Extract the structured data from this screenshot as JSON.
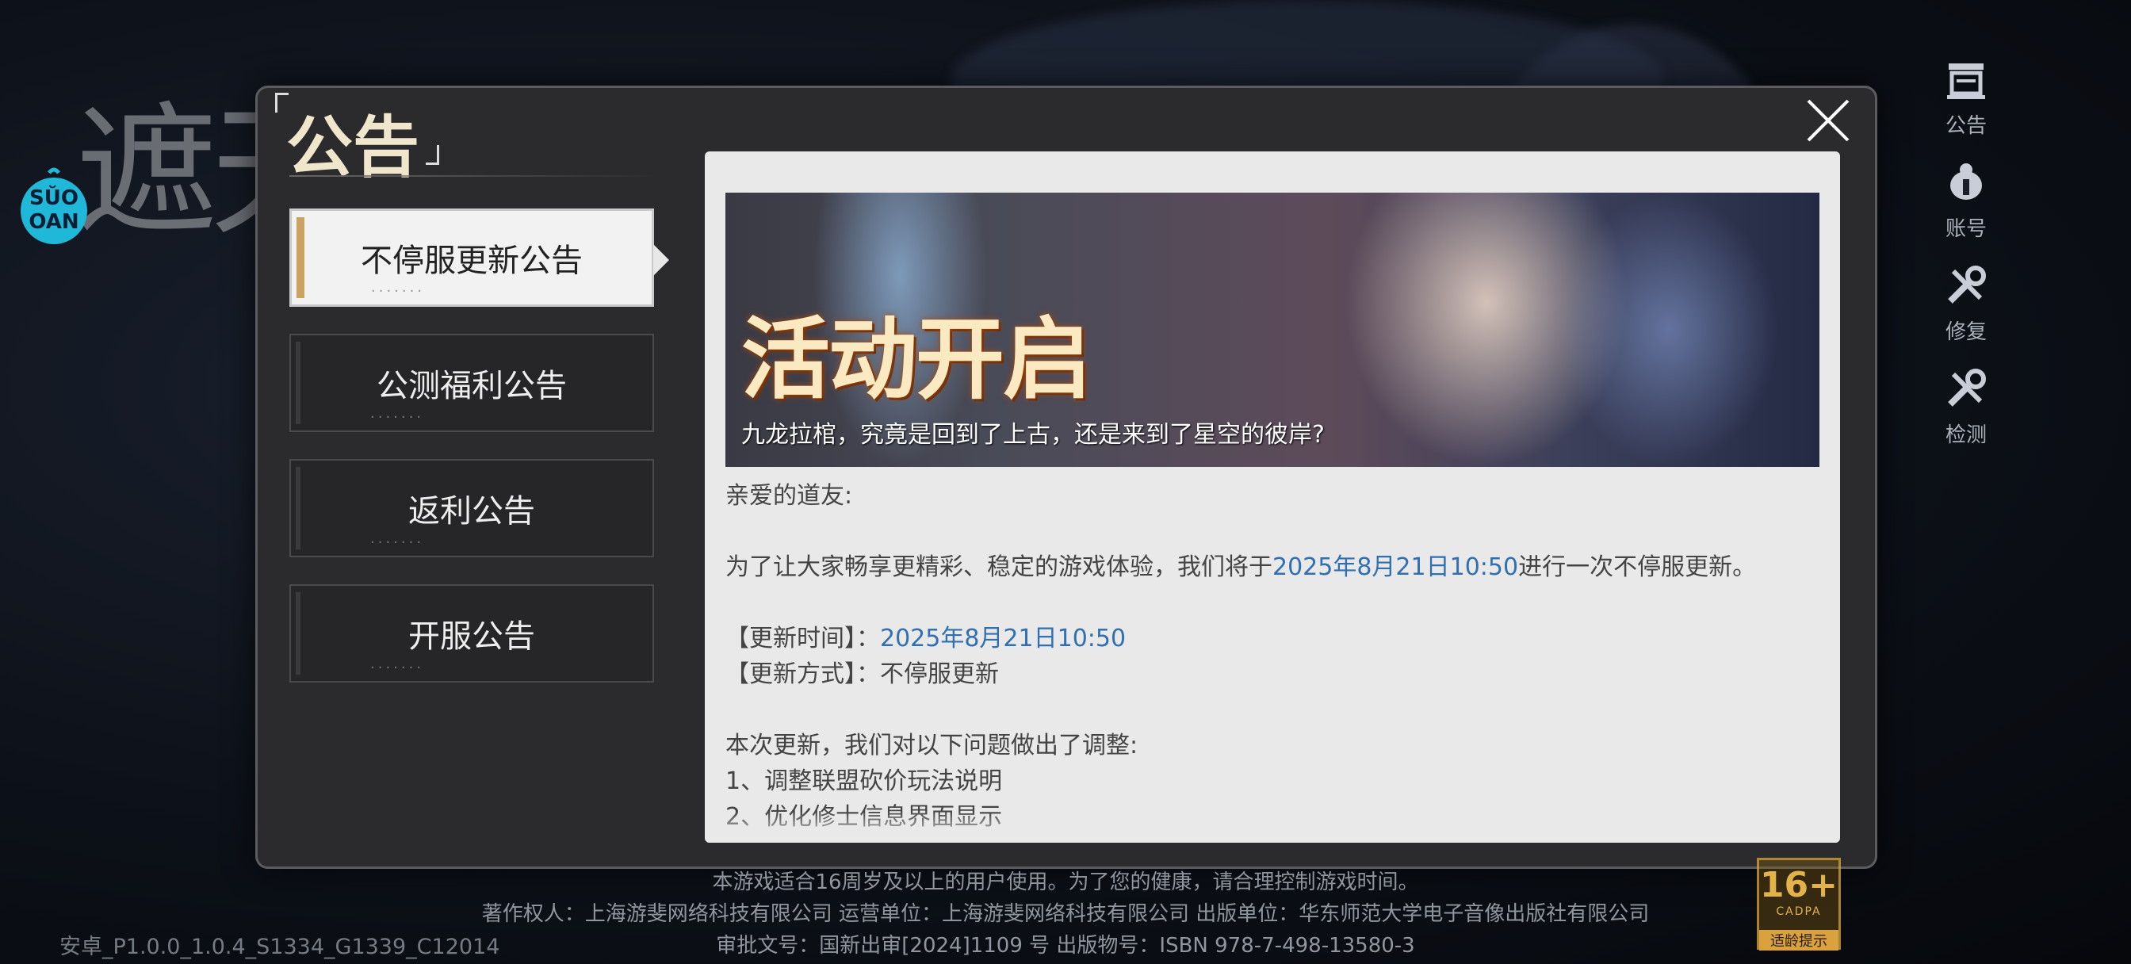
{
  "background": {
    "game_title": "遮天",
    "logo_text": "SŬO OAN"
  },
  "side_menu": [
    {
      "label": "公告",
      "icon": "announcement-icon"
    },
    {
      "label": "账号",
      "icon": "account-icon"
    },
    {
      "label": "修复",
      "icon": "repair-icon"
    },
    {
      "label": "检测",
      "icon": "detect-icon"
    }
  ],
  "dialog": {
    "title": "公告",
    "tabs": [
      {
        "label": "不停服更新公告",
        "active": true
      },
      {
        "label": "公测福利公告",
        "active": false
      },
      {
        "label": "返利公告",
        "active": false
      },
      {
        "label": "开服公告",
        "active": false
      }
    ],
    "banner": {
      "title": "活动开启",
      "caption": "九龙拉棺，究竟是回到了上古，还是来到了星空的彼岸?"
    },
    "content": {
      "greeting": "亲爱的道友:",
      "intro_prefix": "为了让大家畅享更精彩、稳定的游戏体验，我们将于",
      "intro_date": "2025年8月21日10:50",
      "intro_suffix": "进行一次不停服更新。",
      "time_label": "【更新时间】：",
      "time_value": "2025年8月21日10:50",
      "method_label": "【更新方式】：",
      "method_value": "不停服更新",
      "changes_intro": "本次更新，我们对以下问题做出了调整:",
      "change_1": "1、调整联盟砍价玩法说明",
      "change_2": "2、优化修士信息界面显示"
    }
  },
  "footer": {
    "line1": "本游戏适合16周岁及以上的用户使用。为了您的健康，请合理控制游戏时间。",
    "line2": "著作权人：上海游斐网络科技有限公司 运营单位：上海游斐网络科技有限公司 出版单位：华东师范大学电子音像出版社有限公司",
    "line3": "审批文号：国新出审[2024]1109 号 出版物号：ISBN 978-7-498-13580-3",
    "version": "安卓_P1.0.0_1.0.4_S1334_G1339_C12014",
    "age_rating": "16+",
    "age_org": "CADPA",
    "age_tip": "适龄提示"
  },
  "colors": {
    "accent_gold": "#c9a35f",
    "link_blue": "#2f6fb2"
  }
}
